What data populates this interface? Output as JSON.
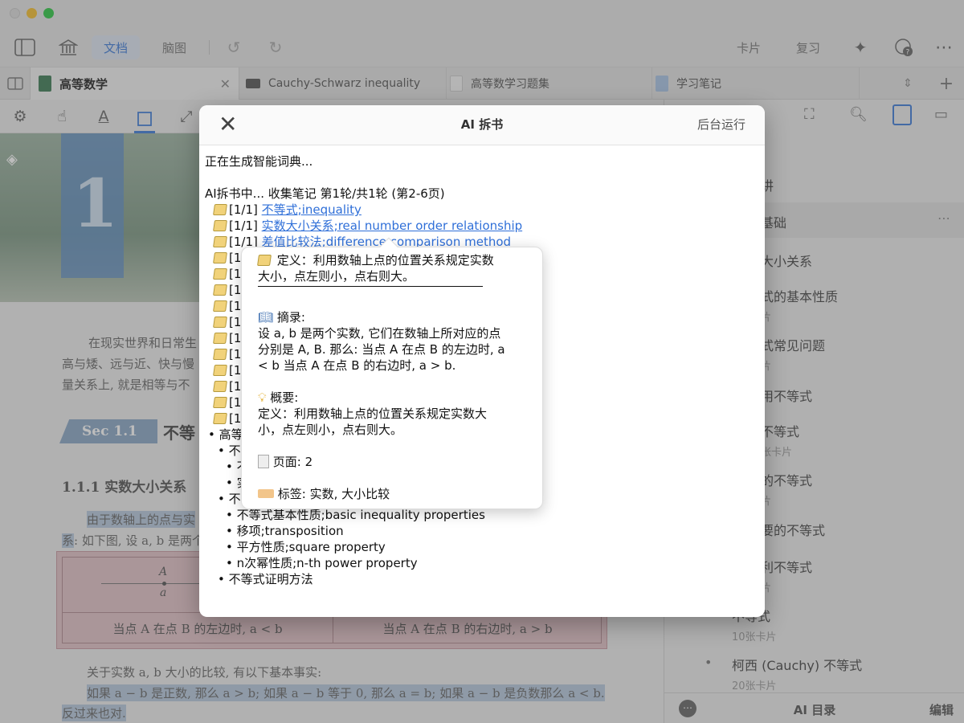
{
  "toolbar": {
    "tab_doc": "文档",
    "tab_mindmap": "脑图",
    "cards": "卡片",
    "review": "复习"
  },
  "tabs": [
    {
      "label": "高等数学"
    },
    {
      "label": "Cauchy-Schwarz inequality"
    },
    {
      "label": "高等数学习题集"
    },
    {
      "label": "学习笔记"
    }
  ],
  "document": {
    "chapter_number": "1",
    "para1_line1": "在现实世界和日常生",
    "para1_line2": "高与矮、远与近、快与慢",
    "para1_line3": "量关系上, 就是相等与不",
    "section_badge": "Sec 1.1",
    "section_title": "不等",
    "subsection": "1.1.1   实数大小关系",
    "hl_line1": "由于数轴上的点与实",
    "hl_line2_prefix": "系",
    "hl_line2_rest": ": 如下图, 设 a, b 是两个",
    "table_point_label": "A",
    "table_point_sub": "a",
    "table_left": "当点 A 在点 B 的左边时, a < b",
    "table_right": "当点 A 在点 B 的右边时, a > b",
    "after_table": "关于实数 a, b 大小的比较, 有以下基本事实:",
    "hl_final1": "如果 a − b 是正数, 那么 a > b; 如果 a − b 等于 0, 那么 a = b; 如果 a − b 是负数那么 a < b.",
    "hl_final2": "反过来也对."
  },
  "sidebar": {
    "items": [
      {
        "title": "讲",
        "sub": ""
      },
      {
        "title": "基础",
        "sub": ""
      },
      {
        "title": "大小关系",
        "sub": ""
      },
      {
        "title": "式的基本性质",
        "sub": "片"
      },
      {
        "title": "式常见问题",
        "sub": "片"
      },
      {
        "title": "用不等式",
        "sub": ""
      },
      {
        "title": "不等式",
        "sub": "张卡片"
      },
      {
        "title": "的不等式",
        "sub": "片"
      },
      {
        "title": "要的不等式",
        "sub": ""
      },
      {
        "title": "利不等式",
        "sub": "片"
      },
      {
        "title": "不等式",
        "sub": "10张卡片"
      },
      {
        "title": "柯西 (Cauchy) 不等式",
        "sub": "20张卡片"
      }
    ],
    "bottom_center": "AI 目录",
    "bottom_right": "编辑"
  },
  "modal": {
    "title": "AI 拆书",
    "background_button": "后台运行",
    "status": "正在生成智能词典...",
    "progress": "AI拆书中... 收集笔记 第1轮/共1轮 (第2-6页)",
    "notes": [
      {
        "prefix": "[1/1]",
        "link": "不等式;inequality"
      },
      {
        "prefix": "[1/1]",
        "link": "实数大小关系;real number order relationship"
      },
      {
        "prefix": "[1/1]",
        "link": "差值比较法;difference comparison method"
      },
      {
        "prefix": "[1",
        "link": ""
      },
      {
        "prefix": "[1",
        "link": ""
      },
      {
        "prefix": "[1",
        "link": ""
      },
      {
        "prefix": "[1",
        "link": ""
      },
      {
        "prefix": "[1",
        "link": ""
      },
      {
        "prefix": "[1",
        "link": ""
      },
      {
        "prefix": "[1",
        "link": ""
      },
      {
        "prefix": "[1",
        "link": ""
      },
      {
        "prefix": "[1",
        "link": ""
      },
      {
        "prefix": "[1",
        "link": ""
      },
      {
        "prefix": "[1",
        "link": ""
      }
    ],
    "outline": {
      "l1": "• 高等",
      "l2a": "• 不等",
      "l3a": "• 不",
      "l3b": "• 实",
      "l2b": "• 不等",
      "l3c": "• 不等式基本性质;basic inequality properties",
      "l3d": "• 移项;transposition",
      "l3e": "• 平方性质;square property",
      "l3f": "• n次幂性质;n-th power property",
      "l2c": "• 不等式证明方法"
    }
  },
  "popover": {
    "def_line1": "定义：利用数轴上点的位置关系规定实数",
    "def_line2": "大小，点左则小，点右则大。",
    "excerpt_label": "摘录:",
    "excerpt_l1": "设 a, b 是两个实数, 它们在数轴上所对应的点",
    "excerpt_l2": "分别是 A, B. 那么: 当点 A 在点 B 的左边时, a",
    "excerpt_l3": "< b 当点 A 在点 B 的右边时, a > b.",
    "summary_label": "概要:",
    "summary_l1": "定义：利用数轴上点的位置关系规定实数大",
    "summary_l2": "小，点左则小，点右则大。",
    "page_label": "页面: 2",
    "tags_label": "标签: 实数, 大小比较"
  }
}
